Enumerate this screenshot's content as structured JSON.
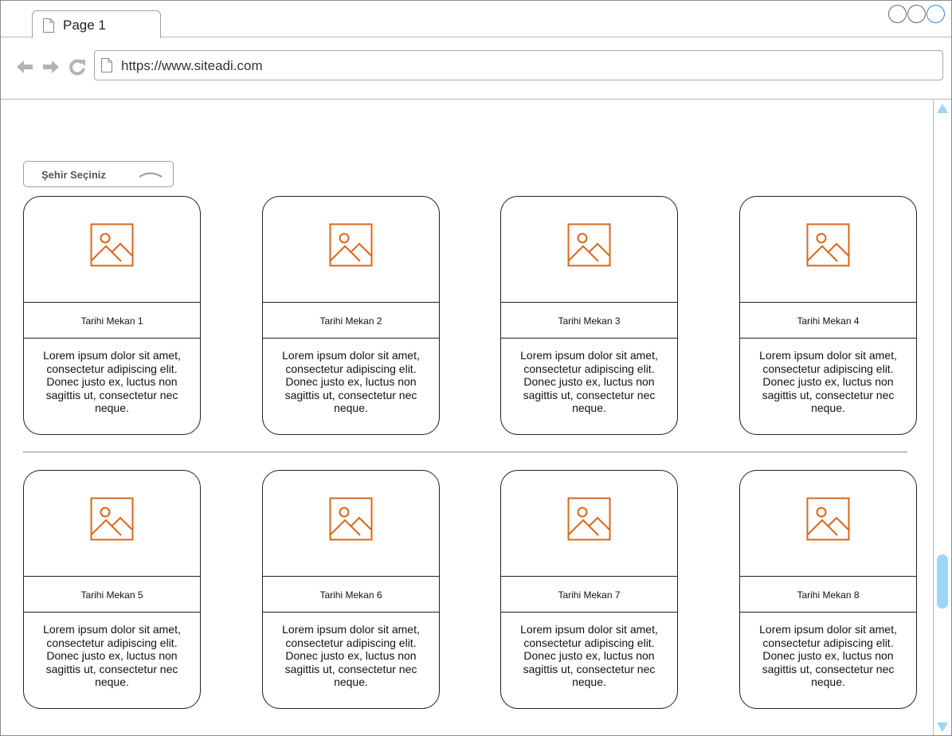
{
  "browser": {
    "tab_title": "Page 1",
    "url": "https://www.siteadi.com",
    "window_controls": [
      "minimize-icon",
      "maximize-icon",
      "close-icon"
    ],
    "nav_icons": [
      "back-arrow-icon",
      "forward-arrow-icon",
      "reload-icon",
      "page-icon"
    ],
    "accent_color": "#2a8ae0",
    "scrollbar_color": "#9ed4f7"
  },
  "city_select": {
    "label": "Şehir Seçiniz"
  },
  "image_icon": "image-placeholder-icon",
  "image_icon_color": "#d9671a",
  "cards": [
    {
      "title": "Tarihi Mekan 1",
      "description": "Lorem ipsum dolor sit amet, consectetur adipiscing elit. Donec justo ex, luctus non sagittis ut, consectetur nec neque."
    },
    {
      "title": "Tarihi Mekan 2",
      "description": "Lorem ipsum dolor sit amet, consectetur adipiscing elit. Donec justo ex, luctus non sagittis ut, consectetur nec neque."
    },
    {
      "title": "Tarihi Mekan 3",
      "description": "Lorem ipsum dolor sit amet, consectetur adipiscing elit. Donec justo ex, luctus non sagittis ut, consectetur nec neque."
    },
    {
      "title": "Tarihi Mekan 4",
      "description": "Lorem ipsum dolor sit amet, consectetur adipiscing elit. Donec justo ex, luctus non sagittis ut, consectetur nec neque."
    },
    {
      "title": "Tarihi Mekan 5",
      "description": "Lorem ipsum dolor sit amet, consectetur adipiscing elit. Donec justo ex, luctus non sagittis ut, consectetur nec neque."
    },
    {
      "title": "Tarihi Mekan 6",
      "description": "Lorem ipsum dolor sit amet, consectetur adipiscing elit. Donec justo ex, luctus non sagittis ut, consectetur nec neque."
    },
    {
      "title": "Tarihi Mekan 7",
      "description": "Lorem ipsum dolor sit amet, consectetur adipiscing elit. Donec justo ex, luctus non sagittis ut, consectetur nec neque."
    },
    {
      "title": "Tarihi Mekan 8",
      "description": "Lorem ipsum dolor sit amet, consectetur adipiscing elit. Donec justo ex, luctus non sagittis ut, consectetur nec neque."
    }
  ]
}
